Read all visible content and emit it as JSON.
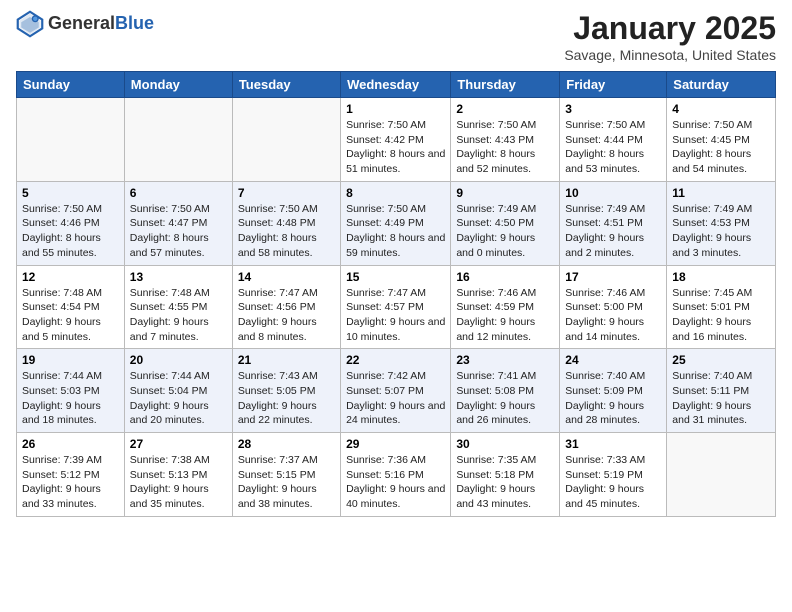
{
  "header": {
    "logo_general": "General",
    "logo_blue": "Blue",
    "month_title": "January 2025",
    "location": "Savage, Minnesota, United States"
  },
  "days_of_week": [
    "Sunday",
    "Monday",
    "Tuesday",
    "Wednesday",
    "Thursday",
    "Friday",
    "Saturday"
  ],
  "weeks": [
    [
      null,
      null,
      null,
      {
        "day": "1",
        "sunrise": "Sunrise: 7:50 AM",
        "sunset": "Sunset: 4:42 PM",
        "daylight": "Daylight: 8 hours and 51 minutes."
      },
      {
        "day": "2",
        "sunrise": "Sunrise: 7:50 AM",
        "sunset": "Sunset: 4:43 PM",
        "daylight": "Daylight: 8 hours and 52 minutes."
      },
      {
        "day": "3",
        "sunrise": "Sunrise: 7:50 AM",
        "sunset": "Sunset: 4:44 PM",
        "daylight": "Daylight: 8 hours and 53 minutes."
      },
      {
        "day": "4",
        "sunrise": "Sunrise: 7:50 AM",
        "sunset": "Sunset: 4:45 PM",
        "daylight": "Daylight: 8 hours and 54 minutes."
      }
    ],
    [
      {
        "day": "5",
        "sunrise": "Sunrise: 7:50 AM",
        "sunset": "Sunset: 4:46 PM",
        "daylight": "Daylight: 8 hours and 55 minutes."
      },
      {
        "day": "6",
        "sunrise": "Sunrise: 7:50 AM",
        "sunset": "Sunset: 4:47 PM",
        "daylight": "Daylight: 8 hours and 57 minutes."
      },
      {
        "day": "7",
        "sunrise": "Sunrise: 7:50 AM",
        "sunset": "Sunset: 4:48 PM",
        "daylight": "Daylight: 8 hours and 58 minutes."
      },
      {
        "day": "8",
        "sunrise": "Sunrise: 7:50 AM",
        "sunset": "Sunset: 4:49 PM",
        "daylight": "Daylight: 8 hours and 59 minutes."
      },
      {
        "day": "9",
        "sunrise": "Sunrise: 7:49 AM",
        "sunset": "Sunset: 4:50 PM",
        "daylight": "Daylight: 9 hours and 0 minutes."
      },
      {
        "day": "10",
        "sunrise": "Sunrise: 7:49 AM",
        "sunset": "Sunset: 4:51 PM",
        "daylight": "Daylight: 9 hours and 2 minutes."
      },
      {
        "day": "11",
        "sunrise": "Sunrise: 7:49 AM",
        "sunset": "Sunset: 4:53 PM",
        "daylight": "Daylight: 9 hours and 3 minutes."
      }
    ],
    [
      {
        "day": "12",
        "sunrise": "Sunrise: 7:48 AM",
        "sunset": "Sunset: 4:54 PM",
        "daylight": "Daylight: 9 hours and 5 minutes."
      },
      {
        "day": "13",
        "sunrise": "Sunrise: 7:48 AM",
        "sunset": "Sunset: 4:55 PM",
        "daylight": "Daylight: 9 hours and 7 minutes."
      },
      {
        "day": "14",
        "sunrise": "Sunrise: 7:47 AM",
        "sunset": "Sunset: 4:56 PM",
        "daylight": "Daylight: 9 hours and 8 minutes."
      },
      {
        "day": "15",
        "sunrise": "Sunrise: 7:47 AM",
        "sunset": "Sunset: 4:57 PM",
        "daylight": "Daylight: 9 hours and 10 minutes."
      },
      {
        "day": "16",
        "sunrise": "Sunrise: 7:46 AM",
        "sunset": "Sunset: 4:59 PM",
        "daylight": "Daylight: 9 hours and 12 minutes."
      },
      {
        "day": "17",
        "sunrise": "Sunrise: 7:46 AM",
        "sunset": "Sunset: 5:00 PM",
        "daylight": "Daylight: 9 hours and 14 minutes."
      },
      {
        "day": "18",
        "sunrise": "Sunrise: 7:45 AM",
        "sunset": "Sunset: 5:01 PM",
        "daylight": "Daylight: 9 hours and 16 minutes."
      }
    ],
    [
      {
        "day": "19",
        "sunrise": "Sunrise: 7:44 AM",
        "sunset": "Sunset: 5:03 PM",
        "daylight": "Daylight: 9 hours and 18 minutes."
      },
      {
        "day": "20",
        "sunrise": "Sunrise: 7:44 AM",
        "sunset": "Sunset: 5:04 PM",
        "daylight": "Daylight: 9 hours and 20 minutes."
      },
      {
        "day": "21",
        "sunrise": "Sunrise: 7:43 AM",
        "sunset": "Sunset: 5:05 PM",
        "daylight": "Daylight: 9 hours and 22 minutes."
      },
      {
        "day": "22",
        "sunrise": "Sunrise: 7:42 AM",
        "sunset": "Sunset: 5:07 PM",
        "daylight": "Daylight: 9 hours and 24 minutes."
      },
      {
        "day": "23",
        "sunrise": "Sunrise: 7:41 AM",
        "sunset": "Sunset: 5:08 PM",
        "daylight": "Daylight: 9 hours and 26 minutes."
      },
      {
        "day": "24",
        "sunrise": "Sunrise: 7:40 AM",
        "sunset": "Sunset: 5:09 PM",
        "daylight": "Daylight: 9 hours and 28 minutes."
      },
      {
        "day": "25",
        "sunrise": "Sunrise: 7:40 AM",
        "sunset": "Sunset: 5:11 PM",
        "daylight": "Daylight: 9 hours and 31 minutes."
      }
    ],
    [
      {
        "day": "26",
        "sunrise": "Sunrise: 7:39 AM",
        "sunset": "Sunset: 5:12 PM",
        "daylight": "Daylight: 9 hours and 33 minutes."
      },
      {
        "day": "27",
        "sunrise": "Sunrise: 7:38 AM",
        "sunset": "Sunset: 5:13 PM",
        "daylight": "Daylight: 9 hours and 35 minutes."
      },
      {
        "day": "28",
        "sunrise": "Sunrise: 7:37 AM",
        "sunset": "Sunset: 5:15 PM",
        "daylight": "Daylight: 9 hours and 38 minutes."
      },
      {
        "day": "29",
        "sunrise": "Sunrise: 7:36 AM",
        "sunset": "Sunset: 5:16 PM",
        "daylight": "Daylight: 9 hours and 40 minutes."
      },
      {
        "day": "30",
        "sunrise": "Sunrise: 7:35 AM",
        "sunset": "Sunset: 5:18 PM",
        "daylight": "Daylight: 9 hours and 43 minutes."
      },
      {
        "day": "31",
        "sunrise": "Sunrise: 7:33 AM",
        "sunset": "Sunset: 5:19 PM",
        "daylight": "Daylight: 9 hours and 45 minutes."
      },
      null
    ]
  ]
}
